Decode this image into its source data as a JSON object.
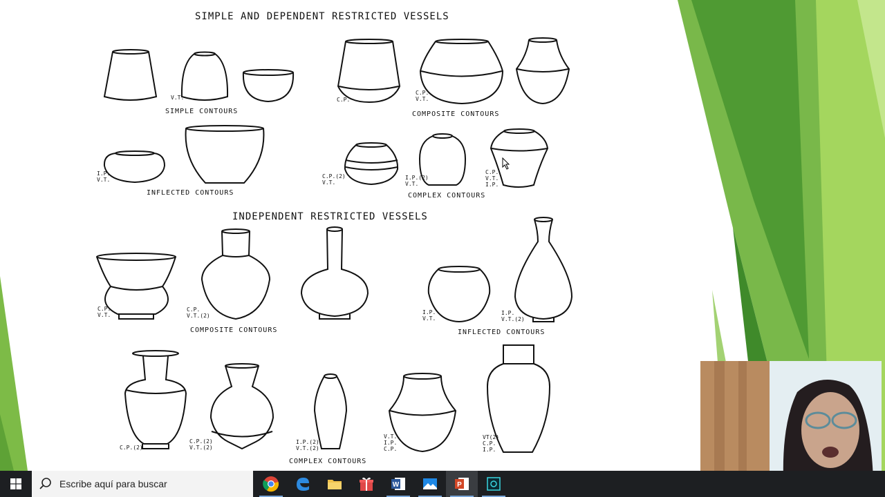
{
  "slide": {
    "heading_top": "SIMPLE AND DEPENDENT RESTRICTED VESSELS",
    "heading_middle": "INDEPENDENT RESTRICTED VESSELS",
    "captions": {
      "simple_contours": "SIMPLE CONTOURS",
      "composite_contours_top": "COMPOSITE CONTOURS",
      "inflected_contours_top": "INFLECTED CONTOURS",
      "complex_contours_top": "COMPLEX CONTOURS",
      "composite_contours_mid": "COMPOSITE CONTOURS",
      "inflected_contours_mid": "INFLECTED CONTOURS",
      "complex_contours_bottom": "COMPLEX CONTOURS"
    },
    "notes": {
      "n1": "V.T.",
      "n2": "C.P.",
      "n3": "C.P.\nV.T.",
      "n4": "I.P.\nV.T.",
      "n5": "C.P.(2)\nV.T.",
      "n6": "I.P.(2)\nV.T.",
      "n7": "C.P.\nV.T.\nI.P.",
      "n8": "C.P.\nV.T.",
      "n9": "C.P.\nV.T.(2)",
      "n10": "I.P.\nV.T.",
      "n11": "I.P.\nV.T.(2)",
      "n12": "C.P.(2)",
      "n13": "C.P.(2)\nV.T.(2)",
      "n14": "I.P.(2)\nV.T.(2)",
      "n15": "V.T.\nI.P.\nC.P.",
      "n16": "VT(2)\nC.P.\nI.P."
    }
  },
  "taskbar": {
    "search_placeholder": "Escribe aquí para buscar",
    "apps": [
      "chrome-icon",
      "edge-icon",
      "file-explorer-icon",
      "gift-app-icon",
      "word-icon",
      "photos-icon",
      "powerpoint-icon",
      "capture-app-icon"
    ]
  },
  "colors": {
    "slide_green_dark": "#3f8a2a",
    "slide_green_mid": "#6cb33f",
    "slide_green_light": "#a4d65e",
    "taskbar_bg": "#1d1f22",
    "search_bg": "#f3f3f3"
  }
}
